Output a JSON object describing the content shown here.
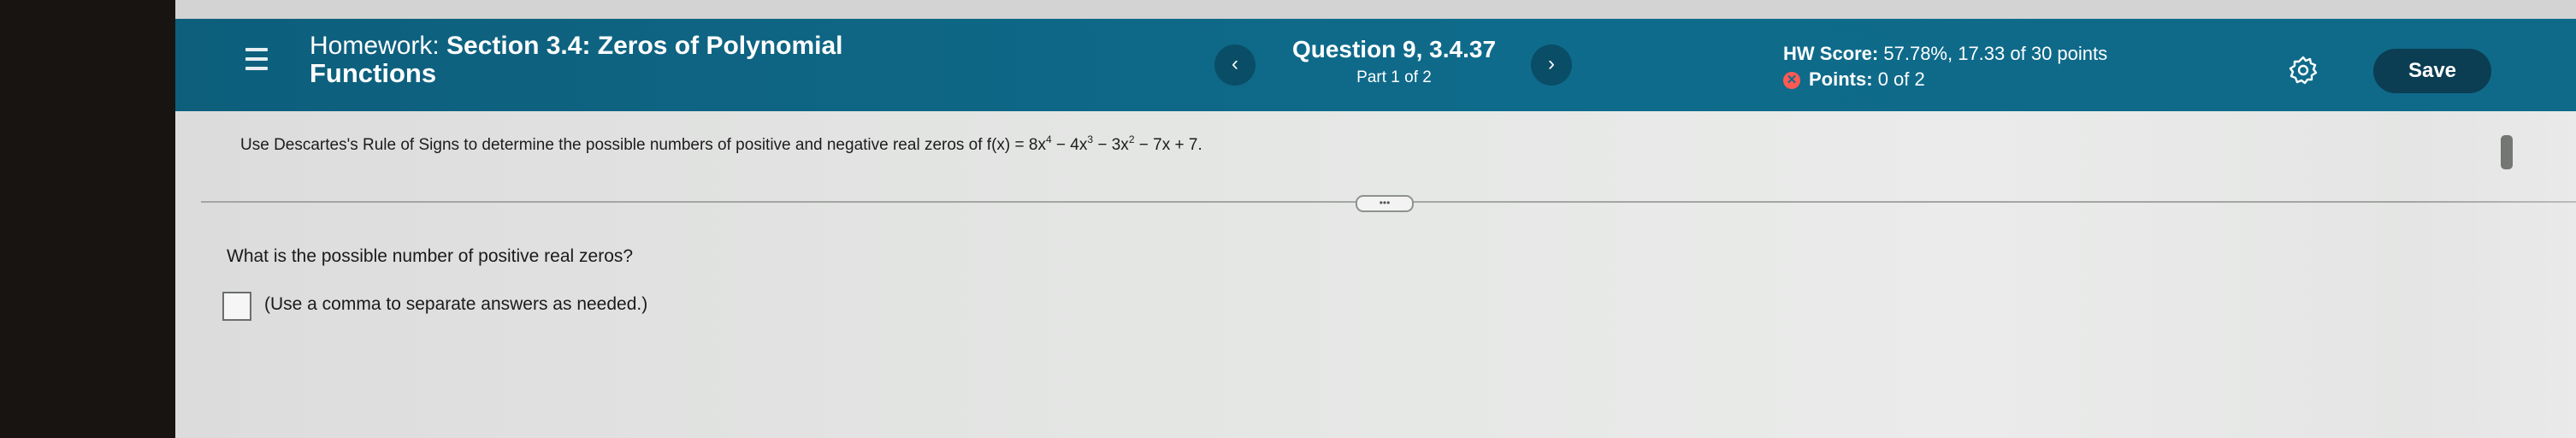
{
  "header": {
    "title_prefix": "Homework:",
    "title_section": "Section 3.4: Zeros of Polynomial",
    "title_line2": "Functions",
    "question_title": "Question 9, 3.4.37",
    "question_part": "Part 1 of 2",
    "prev_glyph": "‹",
    "next_glyph": "›",
    "hw_score_label": "HW Score:",
    "hw_score_value": "57.78%, 17.33 of 30 points",
    "points_label": "Points:",
    "points_value": "0 of 2",
    "points_icon": "x-circle-icon",
    "save_label": "Save"
  },
  "question": {
    "intro": "Use Descartes's Rule of Signs to determine the possible numbers of positive and negative real zeros of f(x) = 8x",
    "exp1": "4",
    "mid1": " − 4x",
    "exp2": "3",
    "mid2": " − 3x",
    "exp3": "2",
    "tail": " − 7x + 7.",
    "more_label": "•••",
    "prompt": "What is the possible number of positive real zeros?",
    "hint": "(Use a comma to separate answers as needed.)"
  },
  "colors": {
    "header_bg": "#0f6b8b",
    "save_bg": "#0b3d53",
    "error_icon": "#ff5a52"
  }
}
